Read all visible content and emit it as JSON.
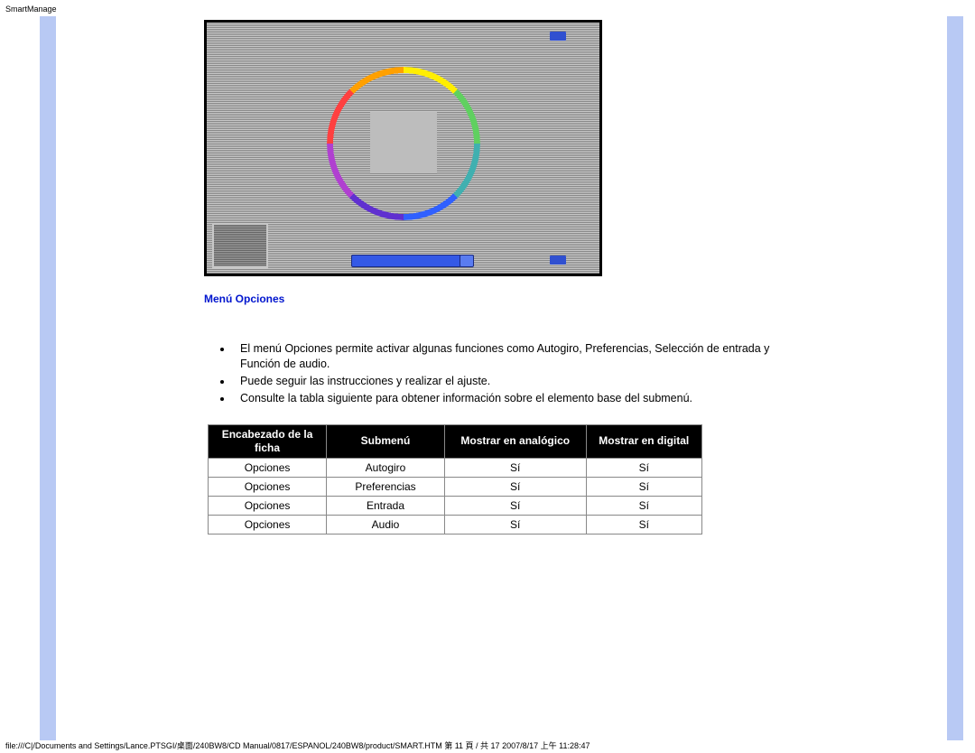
{
  "header_label": "SmartManage",
  "section_title": "Menú Opciones",
  "bullets": [
    "El menú Opciones permite activar algunas funciones como Autogiro, Preferencias, Selección de entrada y Función de audio.",
    "Puede seguir las instrucciones y realizar el ajuste.",
    "Consulte la tabla siguiente para obtener información sobre el elemento base del submenú."
  ],
  "table": {
    "headers": {
      "col0": "Encabezado de la ficha",
      "col1": "Submenú",
      "col2": "Mostrar en analógico",
      "col3": "Mostrar en digital"
    },
    "rows": [
      {
        "c0": "Opciones",
        "c1": "Autogiro",
        "c2": "Sí",
        "c3": "Sí"
      },
      {
        "c0": "Opciones",
        "c1": "Preferencias",
        "c2": "Sí",
        "c3": "Sí"
      },
      {
        "c0": "Opciones",
        "c1": "Entrada",
        "c2": "Sí",
        "c3": "Sí"
      },
      {
        "c0": "Opciones",
        "c1": "Audio",
        "c2": "Sí",
        "c3": "Sí"
      }
    ]
  },
  "footer": "file:///C|/Documents and Settings/Lance.PTSGI/桌面/240BW8/CD Manual/0817/ESPANOL/240BW8/product/SMART.HTM 第 11 頁 / 共 17 2007/8/17 上午 11:28:47"
}
